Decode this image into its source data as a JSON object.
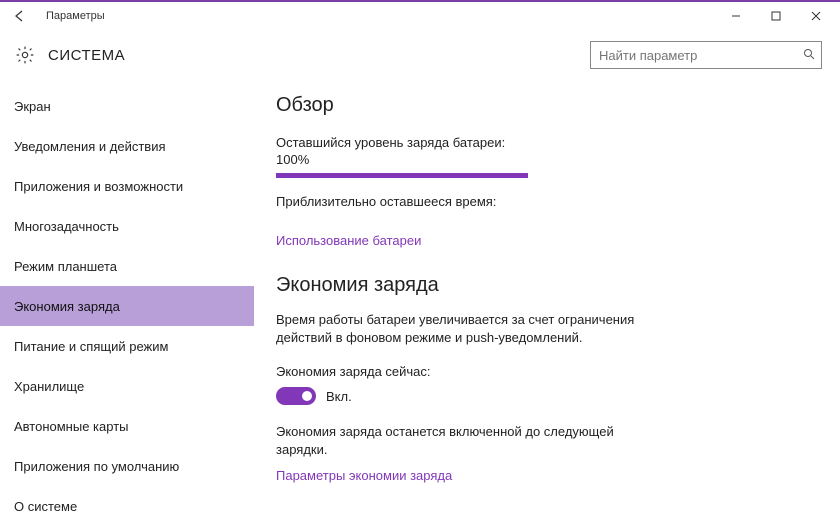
{
  "window": {
    "title": "Параметры"
  },
  "header": {
    "section": "СИСТЕМА"
  },
  "search": {
    "placeholder": "Найти параметр"
  },
  "sidebar": {
    "items": [
      {
        "label": "Экран"
      },
      {
        "label": "Уведомления и действия"
      },
      {
        "label": "Приложения и возможности"
      },
      {
        "label": "Многозадачность"
      },
      {
        "label": "Режим планшета"
      },
      {
        "label": "Экономия заряда"
      },
      {
        "label": "Питание и спящий режим"
      },
      {
        "label": "Хранилище"
      },
      {
        "label": "Автономные карты"
      },
      {
        "label": "Приложения по умолчанию"
      },
      {
        "label": "О системе"
      }
    ],
    "selected_index": 5
  },
  "content": {
    "overview_heading": "Обзор",
    "remaining_label": "Оставшийся уровень заряда батареи:",
    "remaining_value": "100%",
    "remaining_time_label": "Приблизительно оставшееся время:",
    "usage_link": "Использование батареи",
    "saver_heading": "Экономия заряда",
    "saver_desc": "Время работы батареи увеличивается за счет ограничения действий в фоновом режиме и push-уведомлений.",
    "saver_now_label": "Экономия заряда сейчас:",
    "toggle_label": "Вкл.",
    "toggle_on": true,
    "saver_note": "Экономия заряда останется включенной до следующей зарядки.",
    "saver_settings_link": "Параметры экономии заряда"
  },
  "colors": {
    "accent": "#8237b8",
    "sidebar_selected": "#b99fd8"
  }
}
